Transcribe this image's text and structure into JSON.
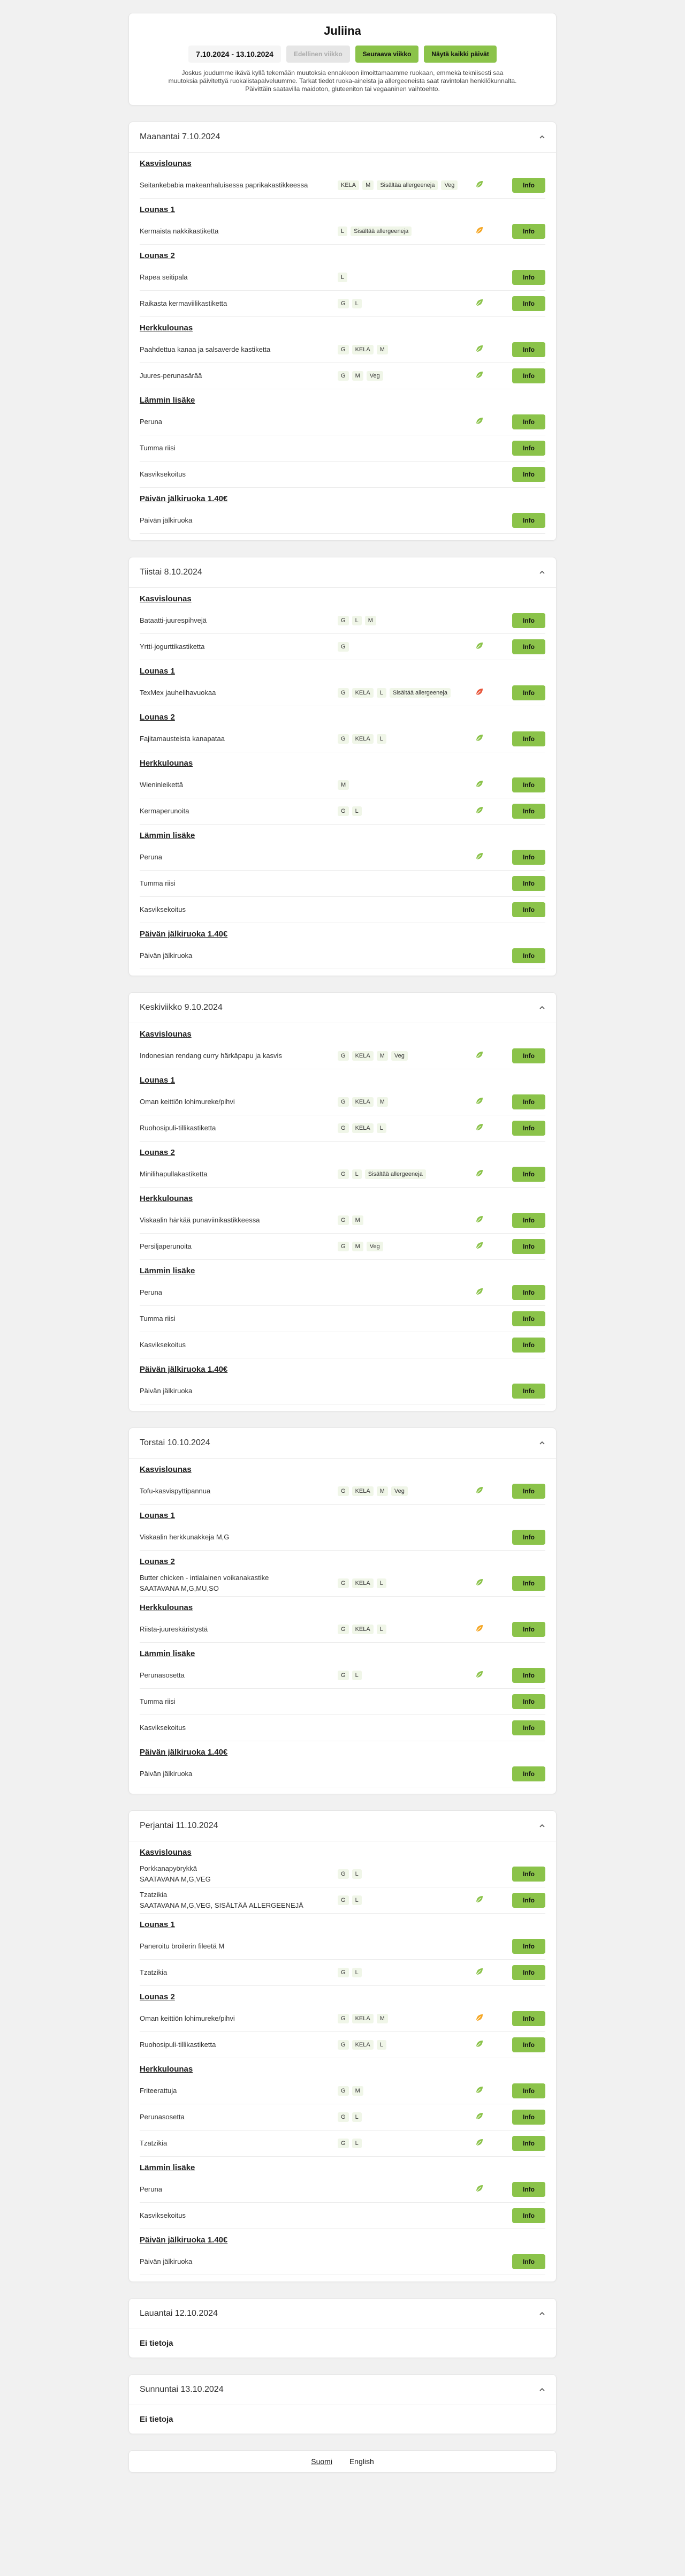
{
  "title": "Juliina",
  "week": {
    "range": "7.10.2024 - 13.10.2024",
    "prev_label": "Edellinen viikko",
    "next_label": "Seuraava viikko",
    "all_label": "Näytä kaikki päivät"
  },
  "disclaimer": "Joskus joudumme ikävä kyllä tekemään muutoksia ennakkoon ilmoittamaamme ruokaan, emmekä tekniisesti saa muutoksia päivitettyä ruokalistapalveluumme. Tarkat tiedot ruoka-aineista ja allergeeneista saat ravintolan henkilökunnalta. Päivittäin saatavilla maidoton, gluteeniton tai vegaaninen vaihtoehto.",
  "info_label": "Info",
  "colors": {
    "accent": "#8bc34a",
    "leaf_green": "#8bc34a",
    "leaf_orange": "#f5a623",
    "leaf_red": "#e8563a"
  },
  "days": [
    {
      "title": "Maanantai 7.10.2024",
      "sections": [
        {
          "title": "Kasvislounas",
          "items": [
            {
              "name": "Seitankebabia makeanhaluisessa paprikakastikkeessa",
              "tags": [
                "KELA",
                "M",
                "Sisältää allergeeneja",
                "Veg"
              ],
              "eco": "green"
            }
          ]
        },
        {
          "title": "Lounas 1",
          "items": [
            {
              "name": "Kermaista nakkikastiketta",
              "tags": [
                "L",
                "Sisältää allergeeneja"
              ],
              "eco": "orange"
            }
          ]
        },
        {
          "title": "Lounas 2",
          "items": [
            {
              "name": "Rapea seitipala",
              "tags": [
                "L"
              ],
              "eco": ""
            },
            {
              "name": "Raikasta kermaviilikastiketta",
              "tags": [
                "G",
                "L"
              ],
              "eco": "green"
            }
          ]
        },
        {
          "title": "Herkkulounas",
          "items": [
            {
              "name": "Paahdettua kanaa ja salsaverde kastiketta",
              "tags": [
                "G",
                "KELA",
                "M"
              ],
              "eco": "green"
            },
            {
              "name": "Juures-perunasärää",
              "tags": [
                "G",
                "M",
                "Veg"
              ],
              "eco": "green"
            }
          ]
        },
        {
          "title": "Lämmin lisäke",
          "items": [
            {
              "name": "Peruna",
              "tags": [],
              "eco": "green"
            },
            {
              "name": "Tumma riisi",
              "tags": [],
              "eco": ""
            },
            {
              "name": "Kasviksekoitus",
              "tags": [],
              "eco": ""
            }
          ]
        },
        {
          "title": "Päivän jälkiruoka 1.40€",
          "items": [
            {
              "name": "Päivän jälkiruoka",
              "tags": [],
              "eco": ""
            }
          ]
        }
      ]
    },
    {
      "title": "Tiistai 8.10.2024",
      "sections": [
        {
          "title": "Kasvislounas",
          "items": [
            {
              "name": "Bataatti-juurespihvejä",
              "tags": [
                "G",
                "L",
                "M"
              ],
              "eco": ""
            },
            {
              "name": "Yrtti-jogurttikastiketta",
              "tags": [
                "G"
              ],
              "eco": "green"
            }
          ]
        },
        {
          "title": "Lounas 1",
          "items": [
            {
              "name": "TexMex jauhelihavuokaa",
              "tags": [
                "G",
                "KELA",
                "L",
                "Sisältää allergeeneja"
              ],
              "eco": "red"
            }
          ]
        },
        {
          "title": "Lounas 2",
          "items": [
            {
              "name": "Fajitamausteista kanapataa",
              "tags": [
                "G",
                "KELA",
                "L"
              ],
              "eco": "green"
            }
          ]
        },
        {
          "title": "Herkkulounas",
          "items": [
            {
              "name": "Wieninleikettä",
              "tags": [
                "M"
              ],
              "eco": "green"
            },
            {
              "name": "Kermaperunoita",
              "tags": [
                "G",
                "L"
              ],
              "eco": "green"
            }
          ]
        },
        {
          "title": "Lämmin lisäke",
          "items": [
            {
              "name": "Peruna",
              "tags": [],
              "eco": "green"
            },
            {
              "name": "Tumma riisi",
              "tags": [],
              "eco": ""
            },
            {
              "name": "Kasviksekoitus",
              "tags": [],
              "eco": ""
            }
          ]
        },
        {
          "title": "Päivän jälkiruoka 1.40€",
          "items": [
            {
              "name": "Päivän jälkiruoka",
              "tags": [],
              "eco": ""
            }
          ]
        }
      ]
    },
    {
      "title": "Keskiviikko 9.10.2024",
      "sections": [
        {
          "title": "Kasvislounas",
          "items": [
            {
              "name": "Indonesian rendang curry härkäpapu ja kasvis",
              "tags": [
                "G",
                "KELA",
                "M",
                "Veg"
              ],
              "eco": "green"
            }
          ]
        },
        {
          "title": "Lounas 1",
          "items": [
            {
              "name": "Oman keittiön lohimureke/pihvi",
              "tags": [
                "G",
                "KELA",
                "M"
              ],
              "eco": "green"
            },
            {
              "name": "Ruohosipuli-tillikastiketta",
              "tags": [
                "G",
                "KELA",
                "L"
              ],
              "eco": "green"
            }
          ]
        },
        {
          "title": "Lounas 2",
          "items": [
            {
              "name": "Minilihapullakastiketta",
              "tags": [
                "G",
                "L",
                "Sisältää allergeeneja"
              ],
              "eco": "green"
            }
          ]
        },
        {
          "title": "Herkkulounas",
          "items": [
            {
              "name": "Viskaalin härkää punaviinikastikkeessa",
              "tags": [
                "G",
                "M"
              ],
              "eco": "green"
            },
            {
              "name": "Persiljaperunoita",
              "tags": [
                "G",
                "M",
                "Veg"
              ],
              "eco": "green"
            }
          ]
        },
        {
          "title": "Lämmin lisäke",
          "items": [
            {
              "name": "Peruna",
              "tags": [],
              "eco": "green"
            },
            {
              "name": "Tumma riisi",
              "tags": [],
              "eco": ""
            },
            {
              "name": "Kasviksekoitus",
              "tags": [],
              "eco": ""
            }
          ]
        },
        {
          "title": "Päivän jälkiruoka 1.40€",
          "items": [
            {
              "name": "Päivän jälkiruoka",
              "tags": [],
              "eco": ""
            }
          ]
        }
      ]
    },
    {
      "title": "Torstai 10.10.2024",
      "sections": [
        {
          "title": "Kasvislounas",
          "items": [
            {
              "name": "Tofu-kasvispyttipannua",
              "tags": [
                "G",
                "KELA",
                "M",
                "Veg"
              ],
              "eco": "green"
            }
          ]
        },
        {
          "title": "Lounas 1",
          "items": [
            {
              "name": "Viskaalin herkkunakkeja M,G",
              "tags": [],
              "eco": ""
            }
          ]
        },
        {
          "title": "Lounas 2",
          "items": [
            {
              "name": "Butter chicken - intialainen voikanakastike",
              "sub": "SAATAVANA M,G,MU,SO",
              "tags": [
                "G",
                "KELA",
                "L"
              ],
              "eco": "green"
            }
          ]
        },
        {
          "title": "Herkkulounas",
          "items": [
            {
              "name": "Riista-juureskäristystä",
              "tags": [
                "G",
                "KELA",
                "L"
              ],
              "eco": "orange"
            }
          ]
        },
        {
          "title": "Lämmin lisäke",
          "items": [
            {
              "name": "Perunasosetta",
              "tags": [
                "G",
                "L"
              ],
              "eco": "green"
            },
            {
              "name": "Tumma riisi",
              "tags": [],
              "eco": ""
            },
            {
              "name": "Kasviksekoitus",
              "tags": [],
              "eco": ""
            }
          ]
        },
        {
          "title": "Päivän jälkiruoka 1.40€",
          "items": [
            {
              "name": "Päivän jälkiruoka",
              "tags": [],
              "eco": ""
            }
          ]
        }
      ]
    },
    {
      "title": "Perjantai 11.10.2024",
      "sections": [
        {
          "title": "Kasvislounas",
          "items": [
            {
              "name": "Porkkanapyörykkä",
              "sub": "SAATAVANA M,G,VEG",
              "tags": [
                "G",
                "L"
              ],
              "eco": ""
            },
            {
              "name": "Tzatzikia",
              "sub": "SAATAVANA M,G,VEG, SISÄLTÄÄ ALLERGEENEJÄ",
              "tags": [
                "G",
                "L"
              ],
              "eco": "green"
            }
          ]
        },
        {
          "title": "Lounas 1",
          "items": [
            {
              "name": "Paneroitu broilerin fileetä M",
              "tags": [],
              "eco": ""
            },
            {
              "name": "Tzatzikia",
              "tags": [
                "G",
                "L"
              ],
              "eco": "green"
            }
          ]
        },
        {
          "title": "Lounas 2",
          "items": [
            {
              "name": "Oman keittiön lohimureke/pihvi",
              "tags": [
                "G",
                "KELA",
                "M"
              ],
              "eco": "orange"
            },
            {
              "name": "Ruohosipuli-tillikastiketta",
              "tags": [
                "G",
                "KELA",
                "L"
              ],
              "eco": "green"
            }
          ]
        },
        {
          "title": "Herkkulounas",
          "items": [
            {
              "name": "Friteerattuja",
              "tags": [
                "G",
                "M"
              ],
              "eco": "green"
            },
            {
              "name": "Perunasosetta",
              "tags": [
                "G",
                "L"
              ],
              "eco": "green"
            },
            {
              "name": "Tzatzikia",
              "tags": [
                "G",
                "L"
              ],
              "eco": "green"
            }
          ]
        },
        {
          "title": "Lämmin lisäke",
          "items": [
            {
              "name": "Peruna",
              "tags": [],
              "eco": "green"
            },
            {
              "name": "Kasviksekoitus",
              "tags": [],
              "eco": ""
            }
          ]
        },
        {
          "title": "Päivän jälkiruoka 1.40€",
          "items": [
            {
              "name": "Päivän jälkiruoka",
              "tags": [],
              "eco": ""
            }
          ]
        }
      ]
    },
    {
      "title": "Lauantai 12.10.2024",
      "empty": "Ei tietoja",
      "sections": []
    },
    {
      "title": "Sunnuntai 13.10.2024",
      "empty": "Ei tietoja",
      "sections": []
    }
  ],
  "footer": {
    "lang_fi": "Suomi",
    "lang_en": "English"
  }
}
